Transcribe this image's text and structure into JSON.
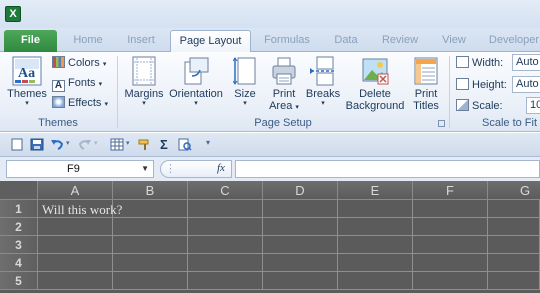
{
  "app": {
    "icon_letter": "X"
  },
  "tabs": [
    {
      "label": "File"
    },
    {
      "label": "Home"
    },
    {
      "label": "Insert"
    },
    {
      "label": "Page Layout"
    },
    {
      "label": "Formulas"
    },
    {
      "label": "Data"
    },
    {
      "label": "Review"
    },
    {
      "label": "View"
    },
    {
      "label": "Developer"
    }
  ],
  "ribbon": {
    "themes_group": {
      "label": "Themes",
      "themes_button": "Themes",
      "colors": "Colors",
      "fonts": "Fonts",
      "effects": "Effects"
    },
    "page_setup_group": {
      "label": "Page Setup",
      "margins": "Margins",
      "orientation": "Orientation",
      "size": "Size",
      "print_area_line1": "Print",
      "print_area_line2": "Area",
      "breaks": "Breaks",
      "background_line1": "Delete",
      "background_line2": "Background",
      "titles_line1": "Print",
      "titles_line2": "Titles"
    },
    "scale_group": {
      "label": "Scale to Fit",
      "width_label": "Width:",
      "width_value": "Auto",
      "height_label": "Height:",
      "height_value": "Auto",
      "scale_label": "Scale:",
      "scale_value": "10"
    }
  },
  "formula_bar": {
    "name_box": "F9",
    "fx_label": "fx",
    "formula_value": ""
  },
  "sheet": {
    "columns": [
      "A",
      "B",
      "C",
      "D",
      "E",
      "F",
      "G"
    ],
    "rows": [
      "1",
      "2",
      "3",
      "4",
      "5"
    ],
    "cells": {
      "A1": "Will this work?"
    }
  },
  "colors": {
    "file_tab": "#2f8a3f",
    "grid_background": "#5b5b5b",
    "ribbon_text": "#1e395b"
  }
}
